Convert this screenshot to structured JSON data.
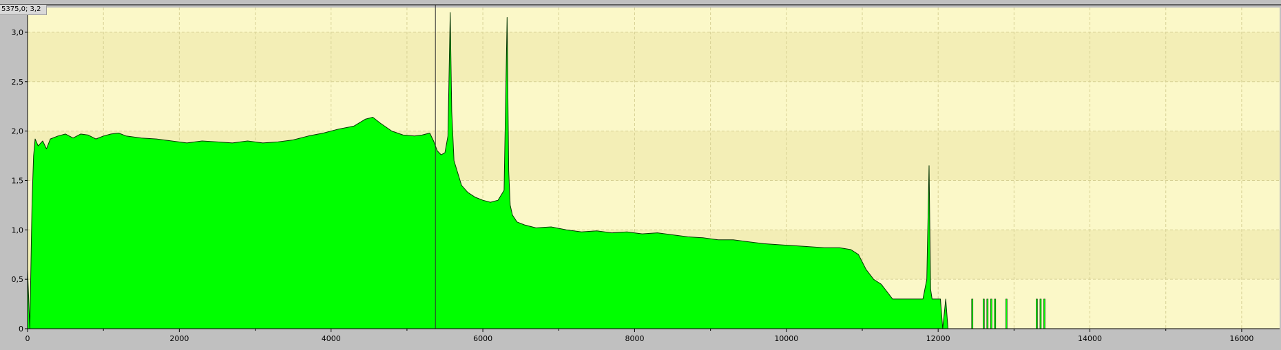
{
  "cursor_readout": "5375,0; 3,2",
  "colors": {
    "plot_background": "#fbf8c8",
    "band_background": "#f3eeb6",
    "fill": "#00ff00",
    "outline": "#003300",
    "frame": "#c0c0c0",
    "grid": "#d6d094"
  },
  "chart_data": {
    "type": "area",
    "title": "",
    "xlabel": "",
    "ylabel": "",
    "xlim": [
      0,
      16500
    ],
    "ylim": [
      0,
      3.25
    ],
    "x_ticks": [
      0,
      2000,
      4000,
      6000,
      8000,
      10000,
      12000,
      14000,
      16000
    ],
    "x_tick_labels": [
      "0",
      "2000",
      "4000",
      "6000",
      "8000",
      "10000",
      "12000",
      "14000",
      "16000"
    ],
    "y_ticks": [
      0,
      0.5,
      1.0,
      1.5,
      2.0,
      2.5,
      3.0
    ],
    "y_tick_labels": [
      "0",
      "0,5",
      "1,0",
      "1,5",
      "2,0",
      "2,5",
      "3,0"
    ],
    "grid": true,
    "cursor_x": 5375,
    "x": [
      0,
      30,
      60,
      80,
      100,
      140,
      200,
      250,
      300,
      400,
      500,
      600,
      700,
      800,
      900,
      1000,
      1100,
      1200,
      1300,
      1500,
      1700,
      1900,
      2100,
      2300,
      2500,
      2700,
      2900,
      3100,
      3300,
      3500,
      3700,
      3900,
      4100,
      4300,
      4450,
      4550,
      4650,
      4800,
      4950,
      5100,
      5200,
      5300,
      5350,
      5400,
      5450,
      5500,
      5540,
      5570,
      5590,
      5620,
      5660,
      5720,
      5800,
      5900,
      6000,
      6100,
      6200,
      6280,
      6320,
      6340,
      6360,
      6390,
      6450,
      6550,
      6700,
      6900,
      7100,
      7300,
      7500,
      7700,
      7900,
      8100,
      8300,
      8500,
      8700,
      8900,
      9100,
      9300,
      9500,
      9700,
      9900,
      10100,
      10300,
      10500,
      10700,
      10850,
      10950,
      11050,
      11150,
      11250,
      11350,
      11400,
      11500,
      11600,
      11700,
      11800,
      11850,
      11880,
      11900,
      11920,
      11950,
      12000,
      12030,
      12060,
      12100,
      12130,
      12160
    ],
    "y": [
      0.6,
      0.0,
      1.3,
      1.75,
      1.92,
      1.85,
      1.9,
      1.82,
      1.92,
      1.95,
      1.97,
      1.93,
      1.97,
      1.96,
      1.92,
      1.95,
      1.97,
      1.98,
      1.95,
      1.93,
      1.92,
      1.9,
      1.88,
      1.9,
      1.89,
      1.88,
      1.9,
      1.88,
      1.89,
      1.91,
      1.95,
      1.98,
      2.02,
      2.05,
      2.12,
      2.14,
      2.08,
      2.0,
      1.96,
      1.95,
      1.96,
      1.98,
      1.9,
      1.8,
      1.76,
      1.78,
      1.95,
      3.2,
      2.2,
      1.7,
      1.6,
      1.45,
      1.38,
      1.33,
      1.3,
      1.28,
      1.3,
      1.4,
      3.15,
      1.6,
      1.25,
      1.15,
      1.08,
      1.05,
      1.02,
      1.03,
      1.0,
      0.98,
      0.99,
      0.97,
      0.98,
      0.96,
      0.97,
      0.95,
      0.93,
      0.92,
      0.9,
      0.9,
      0.88,
      0.86,
      0.85,
      0.84,
      0.83,
      0.82,
      0.82,
      0.8,
      0.75,
      0.6,
      0.5,
      0.45,
      0.35,
      0.3,
      0.3,
      0.3,
      0.3,
      0.3,
      0.5,
      1.65,
      0.4,
      0.3,
      0.3,
      0.3,
      0.3,
      0.0,
      0.3,
      0.0,
      0.0
    ],
    "spikes": [
      {
        "x": 12450,
        "y": 0.3
      },
      {
        "x": 12600,
        "y": 0.3
      },
      {
        "x": 12650,
        "y": 0.3
      },
      {
        "x": 12700,
        "y": 0.3
      },
      {
        "x": 12750,
        "y": 0.3
      },
      {
        "x": 12900,
        "y": 0.3
      },
      {
        "x": 13300,
        "y": 0.3
      },
      {
        "x": 13350,
        "y": 0.3
      },
      {
        "x": 13400,
        "y": 0.3
      }
    ]
  }
}
